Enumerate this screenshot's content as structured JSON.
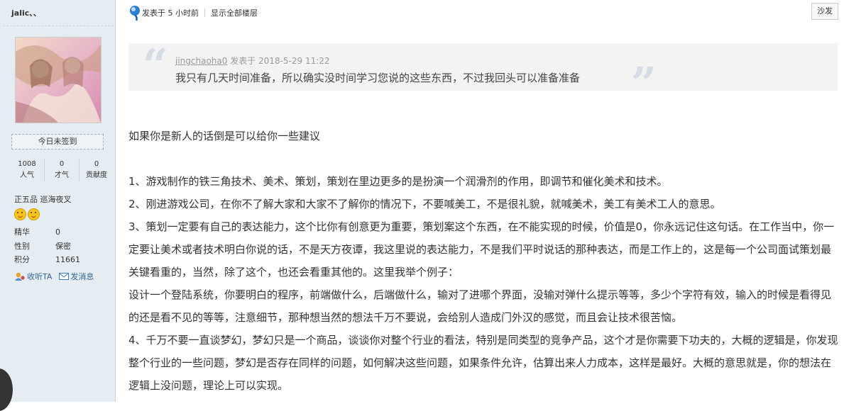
{
  "sidebar": {
    "username": "jalic、、",
    "checkin_label": "今日未签到",
    "stats": [
      {
        "value": "1008",
        "label": "人气"
      },
      {
        "value": "0",
        "label": "才气"
      },
      {
        "value": "0",
        "label": "贡献度"
      }
    ],
    "rank": "正五品 巡海夜叉",
    "info": [
      {
        "key": "精华",
        "value": "0"
      },
      {
        "key": "性别",
        "value": "保密"
      },
      {
        "key": "积分",
        "value": "11661"
      }
    ],
    "actions": {
      "follow": "收听TA",
      "message": "发消息"
    },
    "colors": {
      "background": "#e5edf2",
      "link": "#336699"
    }
  },
  "post": {
    "posted_time": "发表于 5 小时前",
    "show_all": "显示全部楼层",
    "floor_label": "沙发",
    "quote": {
      "author": "jingchaoha0",
      "posted": "发表于 2018-5-29 11:22",
      "text": "我只有几天时间准备，所以确实没时间学习您说的这些东西，不过我回头可以准备准备"
    },
    "paragraphs": [
      "如果你是新人的话倒是可以给你一些建议",
      "1、游戏制作的铁三角技术、美术、策划，策划在里边更多的是扮演一个润滑剂的作用，即调节和催化美术和技术。",
      "2、刚进游戏公司，在你不了解大家和大家不了解你的情况下，不要喊美工，不是很礼貌，就喊美术，美工有美术工人的意思。",
      "3、策划一定要有自己的表达能力，这个比你有创意更为重要，策划案这个东西，在不能实现的时候，价值是0，你永远记住这句话。在工作当中，你一定要让美术或者技术明白你说的话，不是天方夜谭，我这里说的表达能力，不是我们平时说话的那种表达，而是工作上的，这是每一个公司面试策划最关键看重的，当然，除了这个，也还会看重其他的。这里我举个例子：",
      "设计一个登陆系统，你要明白的程序，前端做什么，后端做什么，输对了进哪个界面，没输对弹什么提示等等，多少个字符有效，输入的时候是看得见的还是看不见的等等，注意细节，那种想当然的想法千万不要说，会给别人造成门外汉的感觉，而且会让技术很苦恼。",
      "4、千万不要一直谈梦幻，梦幻只是一个商品，谈谈你对整个行业的看法，特别是同类型的竞争产品，这个才是你需要下功夫的，大概的逻辑是，你发现整个行业的一些问题，梦幻是否存在同样的问题，如何解决这些问题，如果条件允许，估算出来人力成本，这样是最好。大概的意思就是，你的想法在逻辑上没问题，理论上可以实现。"
    ]
  }
}
